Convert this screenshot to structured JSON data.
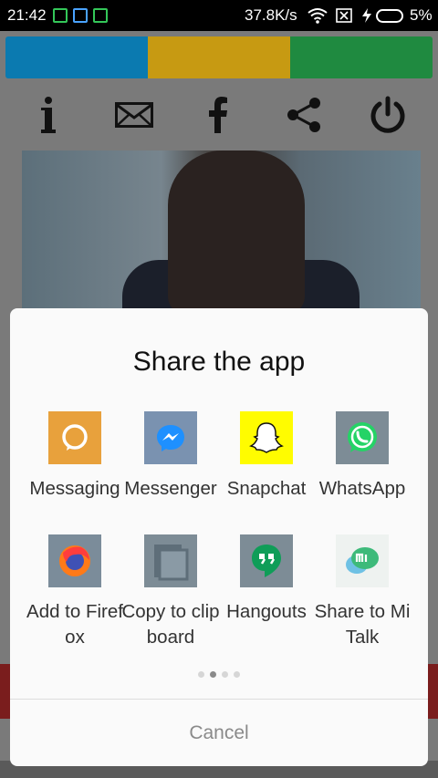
{
  "status": {
    "time": "21:42",
    "speed": "37.8K/s",
    "battery": "5%"
  },
  "colors": {
    "bar_blue": "#039be5",
    "bar_yellow": "#ffc107",
    "bar_green": "#25b14b",
    "bar_blue_dim": "#0b7ab0",
    "bar_yellow_dim": "#c79a12",
    "bar_green_dim": "#1f8a40"
  },
  "toolbar": {
    "icons": [
      "info-icon",
      "mail-icon",
      "facebook-icon",
      "share-icon",
      "power-icon"
    ]
  },
  "share_sheet": {
    "title": "Share the app",
    "apps": [
      {
        "label": "Messaging",
        "icon": "messaging-icon",
        "color": "#e8a13c"
      },
      {
        "label": "Messenger",
        "icon": "messenger-icon",
        "color": "#7a92b0"
      },
      {
        "label": "Snapchat",
        "icon": "snapchat-icon",
        "color": "#fffc00"
      },
      {
        "label": "WhatsApp",
        "icon": "whatsapp-icon",
        "color": "#7d8c96"
      },
      {
        "label": "Add to Firefox",
        "icon": "firefox-icon",
        "color": "#7b8c9a"
      },
      {
        "label": "Copy to clipboard",
        "icon": "clipboard-icon",
        "color": "#7d8c96"
      },
      {
        "label": "Hangouts",
        "icon": "hangouts-icon",
        "color": "#7d8c96"
      },
      {
        "label": "Share to Mi Talk",
        "icon": "mi-talk-icon",
        "color": "#eef2f0"
      }
    ],
    "page_count": 4,
    "current_page": 2,
    "cancel_label": "Cancel"
  }
}
